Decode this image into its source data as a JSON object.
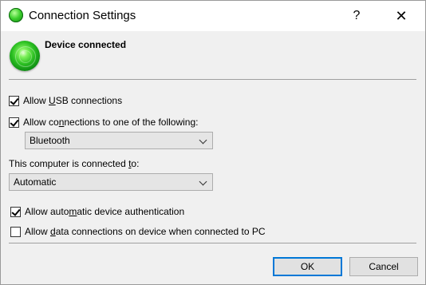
{
  "window": {
    "title": "Connection Settings",
    "help_glyph": "?",
    "close_glyph": "✕"
  },
  "status": {
    "text": "Device connected",
    "icon": "green-orb-icon"
  },
  "options": {
    "allow_usb": {
      "pre": "Allow ",
      "ul": "U",
      "post": "SB connections",
      "checked": true
    },
    "allow_one_of": {
      "pre": "Allow co",
      "ul": "n",
      "post": "nections to one of the following:",
      "checked": true
    },
    "connection_type": {
      "selected": "Bluetooth"
    },
    "connected_to_label": {
      "pre": "This computer is connected ",
      "ul": "t",
      "post": "o:"
    },
    "connected_to": {
      "selected": "Automatic"
    },
    "auto_auth": {
      "pre": "Allow auto",
      "ul": "m",
      "post": "atic device authentication",
      "checked": true
    },
    "data_conn": {
      "pre": "Allow ",
      "ul": "d",
      "post": "ata connections on device when connected to PC",
      "checked": false
    }
  },
  "buttons": {
    "ok": "OK",
    "cancel": "Cancel"
  },
  "colors": {
    "accent": "#0078d7",
    "dialog_bg": "#f0f0f0",
    "status_green": "#2bbf22"
  }
}
